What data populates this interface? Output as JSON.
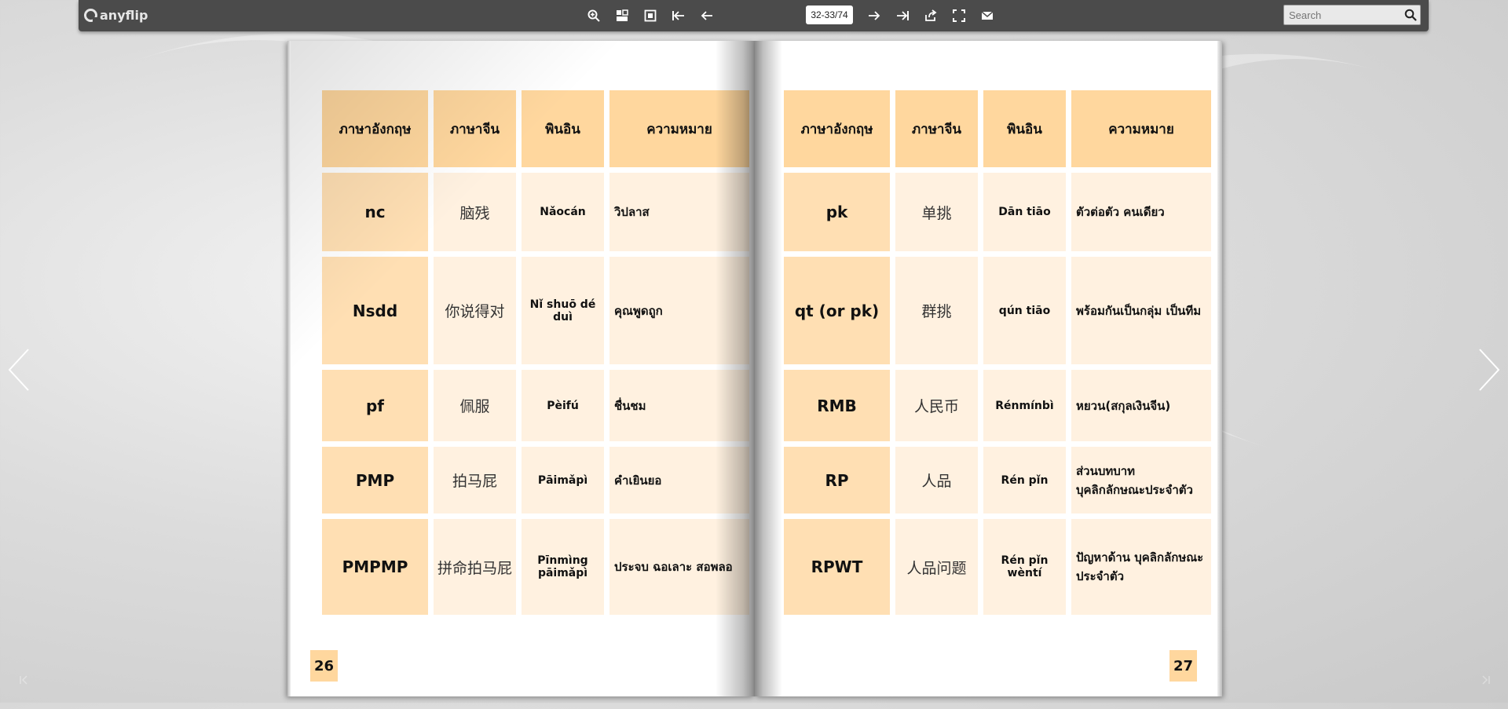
{
  "toolbar": {
    "logo_text": "anyflip",
    "icons": [
      "zoom-in-icon",
      "thumbnails-icon",
      "single-page-icon",
      "first-page-icon",
      "previous-page-icon",
      "next-page-icon",
      "last-page-icon",
      "share-icon",
      "fullscreen-icon",
      "email-icon"
    ],
    "page_indicator": "32-33/74",
    "search_placeholder": "Search"
  },
  "left_page": {
    "page_number": "26",
    "headers": [
      "ภาษาอังกฤษ",
      "ภาษาจีน",
      "พินอิน",
      "ความหมาย"
    ],
    "rows": [
      [
        "nc",
        "脑残",
        "Nǎocán",
        "วิปลาส"
      ],
      [
        "Nsdd",
        "你说得对",
        "Nǐ shuō dé duì",
        "คุณพูดถูก"
      ],
      [
        "pf",
        "佩服",
        "Pèifú",
        "ชื่นชม"
      ],
      [
        "PMP",
        "拍马屁",
        "Pāimǎpì",
        "คำเยินยอ"
      ],
      [
        "PMPMP",
        "拼命拍马屁",
        "Pīnmìng pāimǎpì",
        "ประจบ ฉอเลาะ สอพลอ"
      ]
    ]
  },
  "right_page": {
    "page_number": "27",
    "headers": [
      "ภาษาอังกฤษ",
      "ภาษาจีน",
      "พินอิน",
      "ความหมาย"
    ],
    "rows": [
      [
        "pk",
        "单挑",
        "Dān tiāo",
        "ตัวต่อตัว คนเดียว"
      ],
      [
        "qt (or pk)",
        "群挑",
        "qún tiāo",
        "พร้อมกันเป็นกลุ่ม เป็นทีม"
      ],
      [
        "RMB",
        "人民币",
        "Rénmínbì",
        "หยวน(สกุลเงินจีน)"
      ],
      [
        "RP",
        "人品",
        "Rén pǐn",
        "ส่วนบทบาท บุคลิกลักษณะประจำตัว"
      ],
      [
        "RPWT",
        "人品问题",
        "Rén pǐn wèntí",
        "ปัญหาด้าน บุคลิกลักษณะประจำตัว"
      ]
    ]
  },
  "colors": {
    "toolbar_bg": "#4b4b4b",
    "header_cell": "#ffd79e",
    "abbr_cell": "#ffdfb3",
    "body_cell": "#fff1e0"
  }
}
